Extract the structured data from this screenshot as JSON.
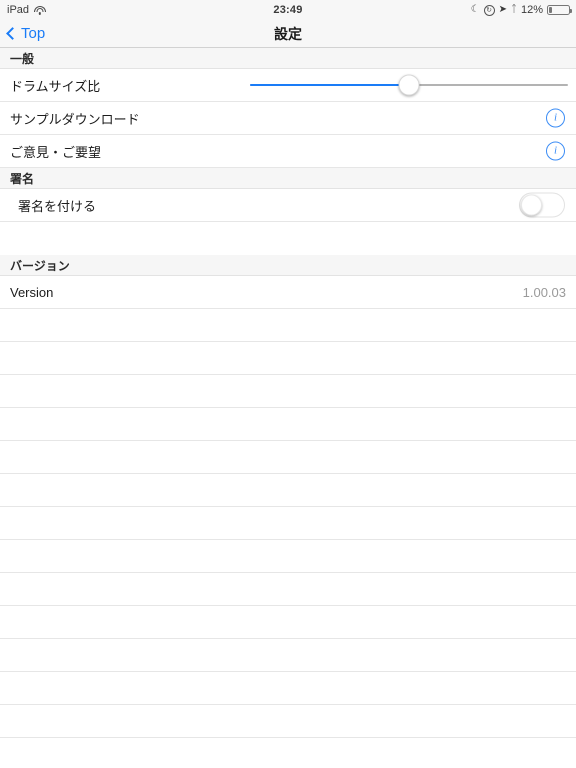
{
  "status_bar": {
    "device": "iPad",
    "wifi_icon": "wifi-icon",
    "time": "23:49",
    "dnd_icon": "moon-icon",
    "rotation_lock_icon": "rotation-lock-icon",
    "location_icon": "location-arrow-icon",
    "bluetooth_icon": "bluetooth-icon",
    "battery_percent": "12%",
    "battery_icon": "battery-icon",
    "battery_level": 12
  },
  "nav_bar": {
    "back_label": "Top",
    "back_icon": "chevron-left-icon",
    "title": "設定"
  },
  "sections": [
    {
      "header": "一般",
      "rows": [
        {
          "label": "ドラムサイズ比",
          "control": "slider",
          "slider_value": 50
        },
        {
          "label": "サンプルダウンロード",
          "control": "info",
          "info_icon": "info-circle-icon"
        },
        {
          "label": "ご意見・ご要望",
          "control": "info",
          "info_icon": "info-circle-icon"
        }
      ]
    },
    {
      "header": "署名",
      "rows": [
        {
          "label": "署名を付ける",
          "control": "toggle",
          "toggle_on": false
        }
      ]
    },
    {
      "header": "バージョン",
      "rows": [
        {
          "label": "Version",
          "control": "value",
          "value": "1.00.03"
        }
      ]
    }
  ],
  "empty_rows_count": 13,
  "colors": {
    "accent": "#1a7cf7",
    "info_blue": "#3b8cf5",
    "section_bg": "#f6f6f6",
    "separator": "#e6e6e6",
    "value_text": "#9a9a9a"
  }
}
